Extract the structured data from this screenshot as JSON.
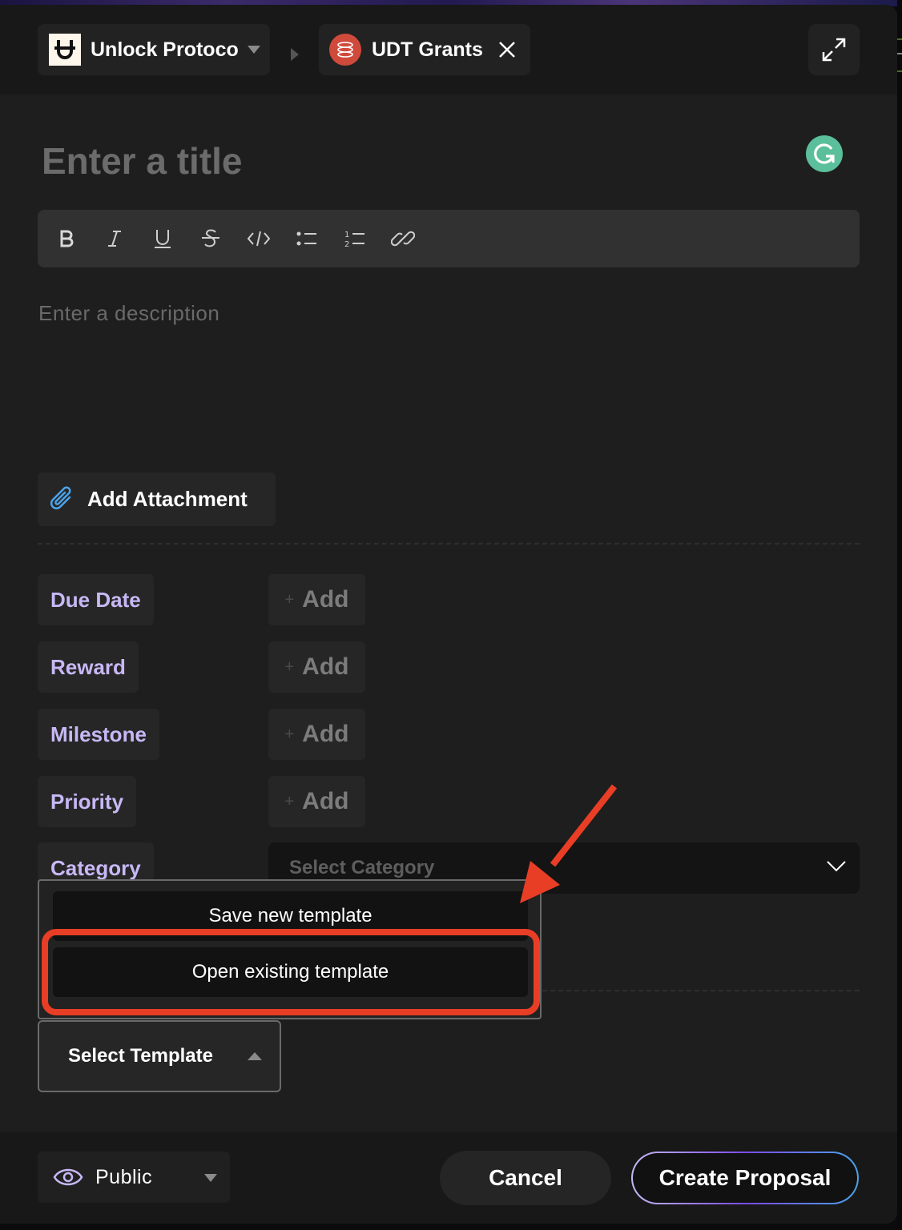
{
  "header": {
    "workspace_name": "Unlock Protocol",
    "board_name": "UDT Grants"
  },
  "editor": {
    "title_placeholder": "Enter a title",
    "description_placeholder": "Enter a description",
    "toolbar": [
      {
        "name": "bold",
        "glyph": "B"
      },
      {
        "name": "italic",
        "glyph": "I"
      },
      {
        "name": "underline",
        "glyph": "U"
      },
      {
        "name": "strikethrough",
        "glyph": "S"
      },
      {
        "name": "code",
        "glyph": "</>"
      },
      {
        "name": "bullet-list",
        "glyph": ""
      },
      {
        "name": "numbered-list",
        "glyph": ""
      },
      {
        "name": "link",
        "glyph": ""
      }
    ],
    "add_attachment_label": "Add Attachment"
  },
  "properties": [
    {
      "label": "Due Date",
      "action": "Add"
    },
    {
      "label": "Reward",
      "action": "Add"
    },
    {
      "label": "Milestone",
      "action": "Add"
    },
    {
      "label": "Priority",
      "action": "Add"
    },
    {
      "label": "Category",
      "placeholder": "Select Category"
    }
  ],
  "add_plus": "+",
  "template_menu": {
    "items": [
      "Save new template",
      "Open existing template"
    ],
    "highlighted_item": "Open existing template"
  },
  "select_template_label": "Select Template",
  "footer": {
    "visibility": "Public",
    "cancel_label": "Cancel",
    "create_label": "Create Proposal"
  },
  "colors": {
    "accent_label": "#c7b8f5",
    "annotation": "#e83e25",
    "grammarly": "#5bbf9c",
    "board_logo": "#d04a3c"
  }
}
